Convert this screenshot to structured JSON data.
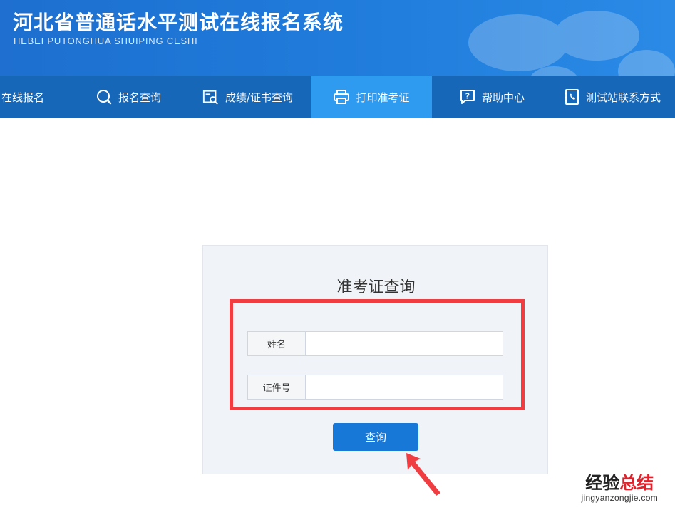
{
  "header": {
    "title": "河北省普通话水平测试在线报名系统",
    "subtitle": "HEBEI PUTONGHUA SHUIPING CESHI"
  },
  "nav": {
    "items": [
      {
        "label": "在线报名",
        "icon": "none"
      },
      {
        "label": "报名查询",
        "icon": "search-icon"
      },
      {
        "label": "成绩/证书查询",
        "icon": "certificate-search-icon"
      },
      {
        "label": "打印准考证",
        "icon": "printer-icon",
        "active": true
      },
      {
        "label": "帮助中心",
        "icon": "help-icon"
      },
      {
        "label": "测试站联系方式",
        "icon": "phone-book-icon"
      }
    ]
  },
  "form": {
    "title": "准考证查询",
    "name_label": "姓名",
    "name_value": "",
    "id_label": "证件号",
    "id_value": "",
    "submit_label": "查询"
  },
  "watermark": {
    "main_prefix": "经验",
    "main_accent": "总结",
    "sub": "jingyanzongjie.com"
  },
  "colors": {
    "header_blue": "#1f7ad9",
    "nav_blue": "#1667b8",
    "nav_active": "#2f9bf0",
    "button_blue": "#1878d8",
    "highlight_red": "#ef3d42"
  }
}
